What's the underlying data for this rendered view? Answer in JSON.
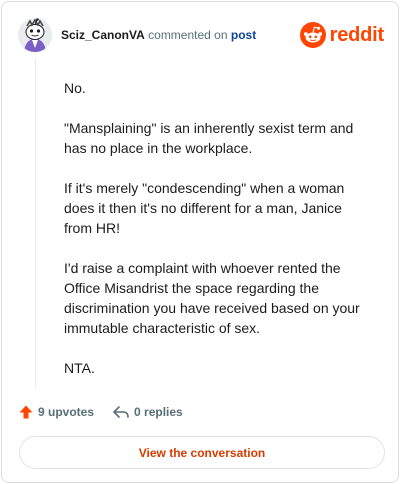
{
  "header": {
    "username": "Sciz_CanonVA",
    "action_text": "commented on",
    "post_link": "post",
    "logo_text": "reddit"
  },
  "comment": {
    "paragraphs": [
      "No.",
      "\"Mansplaining\" is an inherently sexist term and has no place in the workplace.",
      "If it's merely \"condescending\" when a woman does it then it's no different for a man, Janice from HR!",
      "I'd raise a complaint with whoever rented the Office Misandrist the space regarding the discrimination you have received based on your immutable characteristic of sex.",
      "NTA."
    ]
  },
  "actions": {
    "upvotes": "9 upvotes",
    "replies": "0 replies"
  },
  "cta": {
    "label": "View the conversation"
  },
  "colors": {
    "brand": "#ff4500",
    "link": "#0a449b",
    "cta_text": "#d93a00",
    "muted": "#576f76"
  },
  "icons": [
    "avatar",
    "reddit-logo-icon",
    "upvote-arrow-icon",
    "reply-arrow-icon"
  ]
}
